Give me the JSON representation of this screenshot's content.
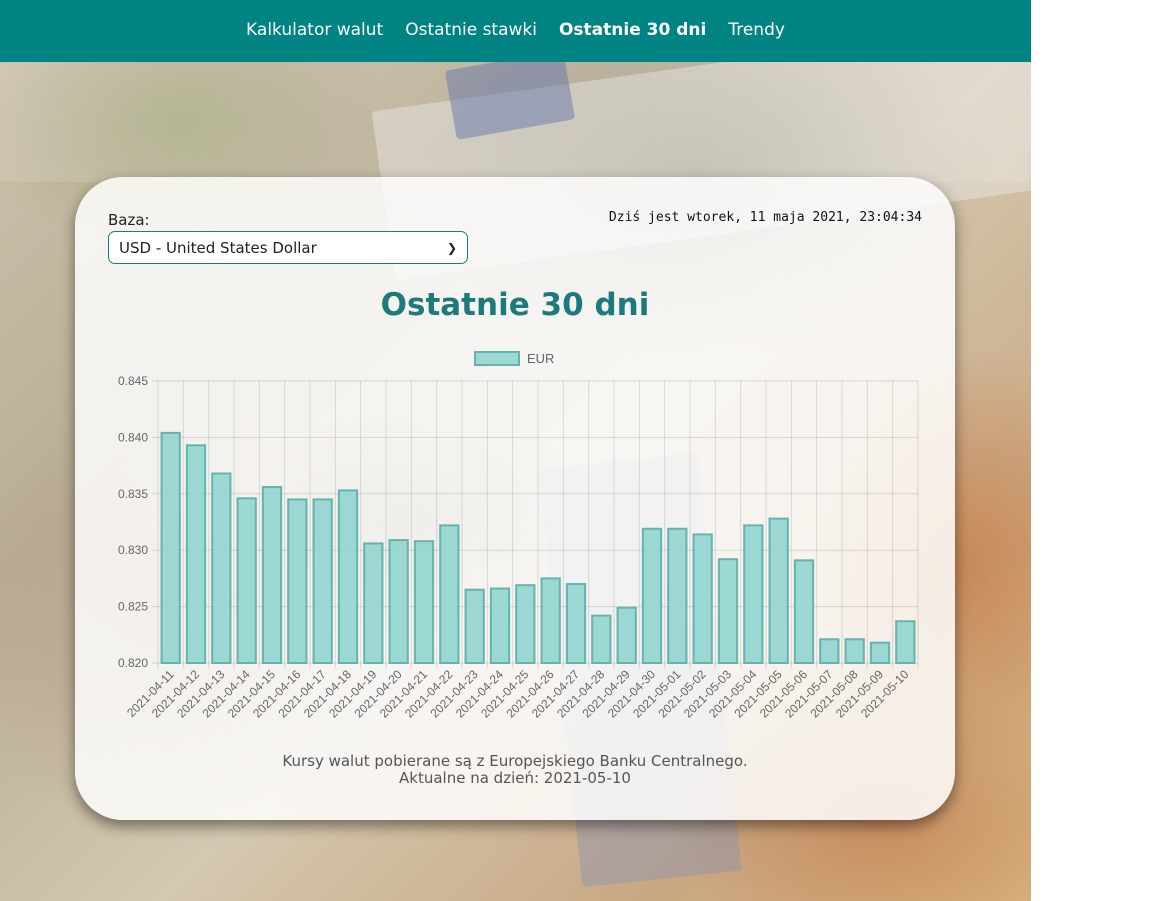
{
  "nav": {
    "items": [
      {
        "label": "Kalkulator walut",
        "active": false
      },
      {
        "label": "Ostatnie stawki",
        "active": false
      },
      {
        "label": "Ostatnie 30 dni",
        "active": true
      },
      {
        "label": "Trendy",
        "active": false
      }
    ]
  },
  "base": {
    "label": "Baza:",
    "selected": "USD - United States Dollar"
  },
  "date_text": "Dziś jest wtorek, 11 maja 2021, 23:04:34",
  "page_title": "Ostatnie 30 dni",
  "footer": {
    "line1": "Kursy walut pobierane są z Europejskiego Banku Centralnego.",
    "line2": "Aktualne na dzień: 2021-05-10"
  },
  "colors": {
    "accent": "#008483",
    "title": "#1c7a7a",
    "bar_fill": "#8cd4cf",
    "bar_stroke": "#65b3ad"
  },
  "chart_data": {
    "type": "bar",
    "legend_position": "top",
    "grid": true,
    "ylim": [
      0.82,
      0.845
    ],
    "yticks": [
      "0.845",
      "0.840",
      "0.835",
      "0.830",
      "0.825",
      "0.820"
    ],
    "categories": [
      "2021-04-11",
      "2021-04-12",
      "2021-04-13",
      "2021-04-14",
      "2021-04-15",
      "2021-04-16",
      "2021-04-17",
      "2021-04-18",
      "2021-04-19",
      "2021-04-20",
      "2021-04-21",
      "2021-04-22",
      "2021-04-23",
      "2021-04-24",
      "2021-04-25",
      "2021-04-26",
      "2021-04-27",
      "2021-04-28",
      "2021-04-29",
      "2021-04-30",
      "2021-05-01",
      "2021-05-02",
      "2021-05-03",
      "2021-05-04",
      "2021-05-05",
      "2021-05-06",
      "2021-05-07",
      "2021-05-08",
      "2021-05-09",
      "2021-05-10"
    ],
    "series": [
      {
        "name": "EUR",
        "values": [
          0.8404,
          0.8393,
          0.8368,
          0.8346,
          0.8356,
          0.8345,
          0.8345,
          0.8353,
          0.8306,
          0.8309,
          0.8308,
          0.8322,
          0.8265,
          0.8266,
          0.8269,
          0.8275,
          0.827,
          0.8242,
          0.8249,
          0.8319,
          0.8319,
          0.8314,
          0.8292,
          0.8322,
          0.8328,
          0.8291,
          0.8221,
          0.8221,
          0.8218,
          0.8237
        ]
      }
    ]
  }
}
